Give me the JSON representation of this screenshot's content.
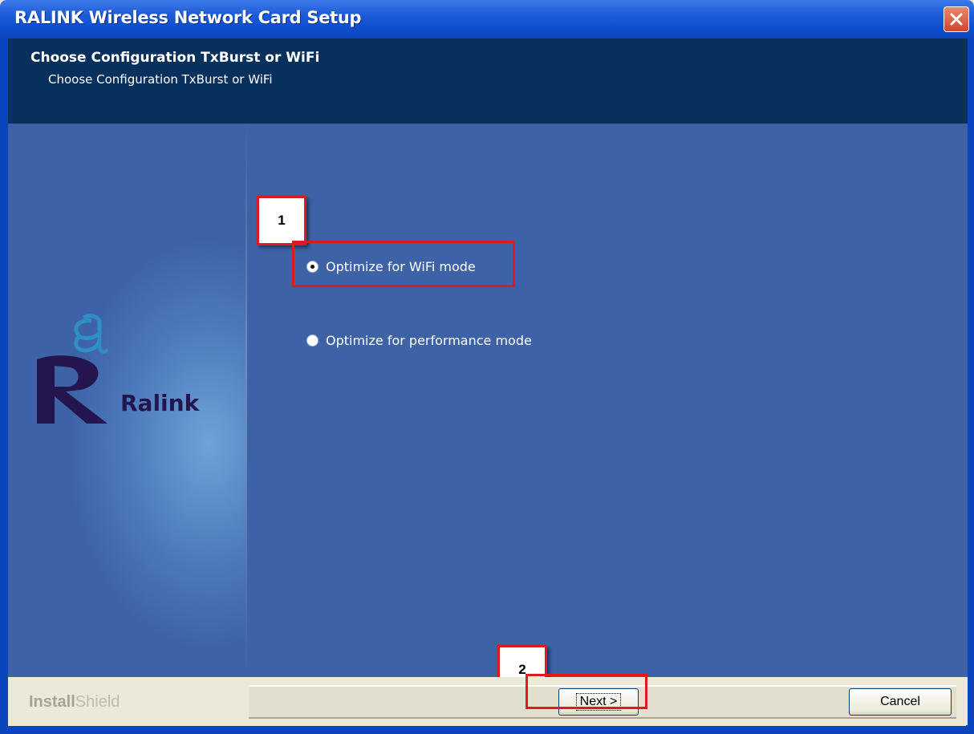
{
  "window": {
    "title": "RALINK Wireless Network Card Setup"
  },
  "header": {
    "title": "Choose Configuration TxBurst or WiFi",
    "subtitle": "Choose Configuration TxBurst or WiFi"
  },
  "logo": {
    "text": "Ralink"
  },
  "options": [
    {
      "label": "Optimize for WiFi mode",
      "checked": true
    },
    {
      "label": "Optimize for performance mode",
      "checked": false
    }
  ],
  "annotations": {
    "step1": "1",
    "step2": "2"
  },
  "footer": {
    "brand_bold": "Install",
    "brand_light": "Shield",
    "next_label": "Next >",
    "cancel_label": "Cancel"
  },
  "colors": {
    "body_bg": "#3e62a6",
    "header_bg": "#07305c",
    "annotation": "#e0191e"
  }
}
